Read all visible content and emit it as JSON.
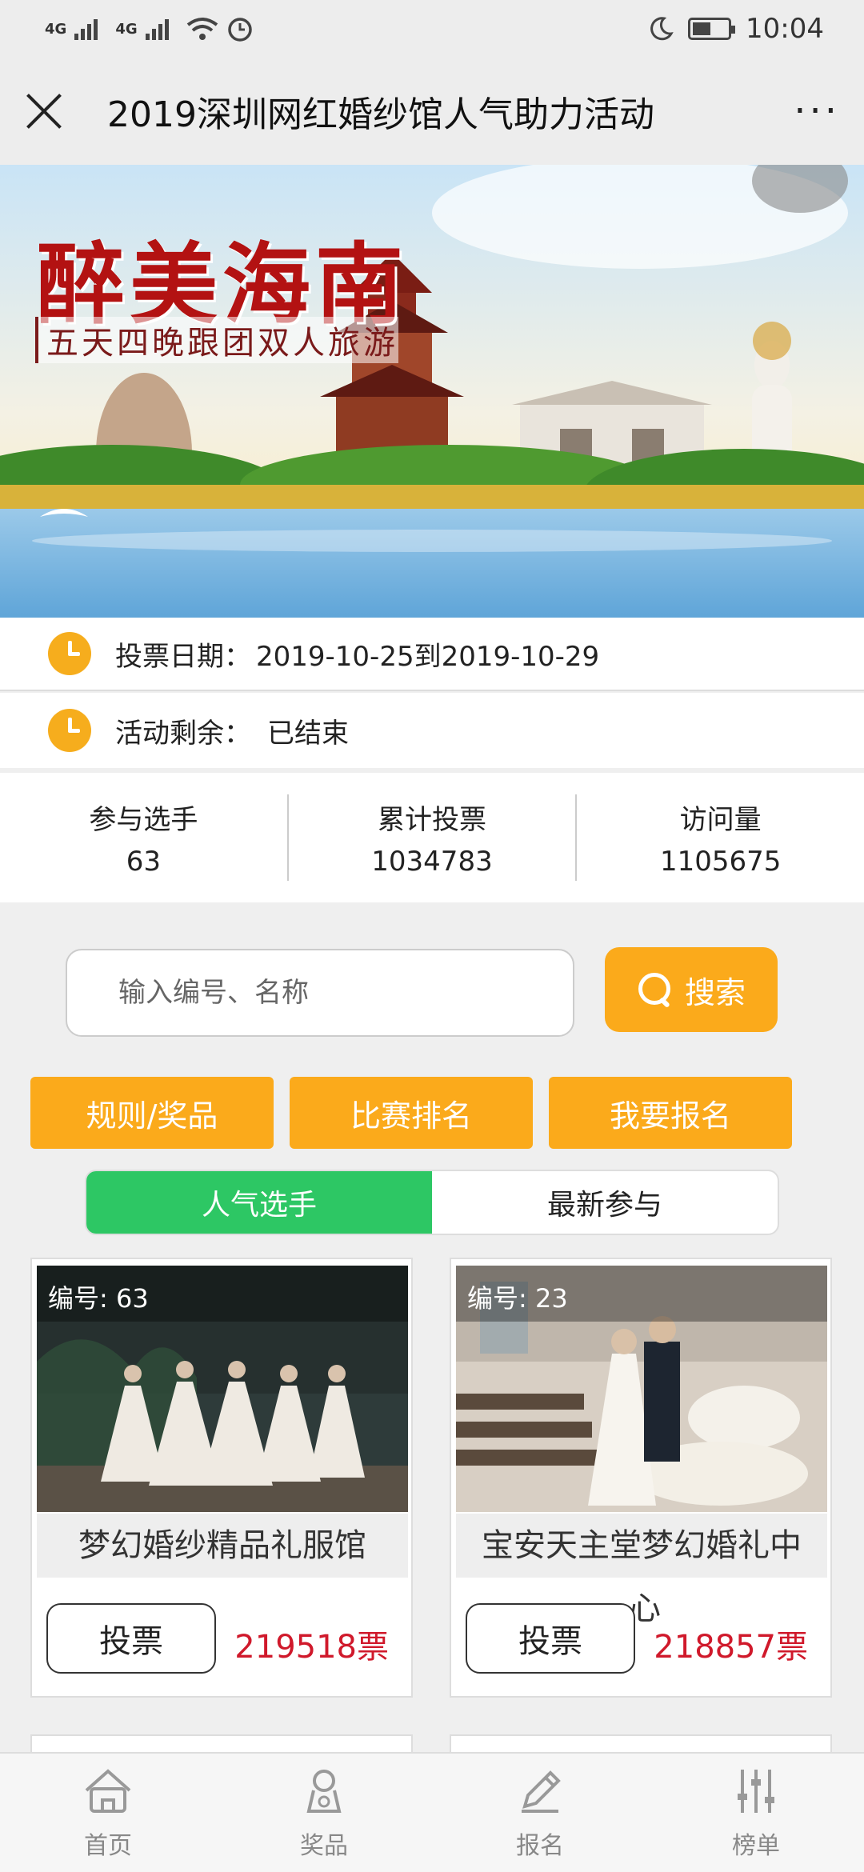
{
  "status_bar": {
    "network1": "4G",
    "network2": "4G",
    "time": "10:04"
  },
  "header": {
    "title": "2019深圳网红婚纱馆人气助力活动",
    "more": "···"
  },
  "banner": {
    "title": "醉美海南",
    "subtitle": "五天四晚跟团双人旅游"
  },
  "info": {
    "vote_date_label": "投票日期：",
    "vote_date_value": "2019-10-25到2019-10-29",
    "remaining_label": "活动剩余：",
    "remaining_value": "已结束"
  },
  "stats": [
    {
      "label": "参与选手",
      "value": "63"
    },
    {
      "label": "累计投票",
      "value": "1034783"
    },
    {
      "label": "访问量",
      "value": "1105675"
    }
  ],
  "search": {
    "placeholder": "输入编号、名称",
    "button": "搜索"
  },
  "actions": {
    "rules": "规则/奖品",
    "ranking": "比赛排名",
    "signup": "我要报名"
  },
  "tabs": {
    "popular": "人气选手",
    "latest": "最新参与"
  },
  "cards": [
    {
      "number": "编号: 63",
      "name": "梦幻婚纱精品礼服馆",
      "name_overflow": "",
      "vote_label": "投票",
      "votes": "219518票"
    },
    {
      "number": "编号: 23",
      "name": "宝安天主堂梦幻婚礼中",
      "name_overflow": "心",
      "vote_label": "投票",
      "votes": "218857票"
    }
  ],
  "bottom_nav": {
    "home": "首页",
    "prizes": "奖品",
    "signup": "报名",
    "ranking": "榜单"
  },
  "colors": {
    "accent_orange": "#fbaa1b",
    "tab_green": "#2dc764",
    "votes_red": "#d0192b"
  }
}
